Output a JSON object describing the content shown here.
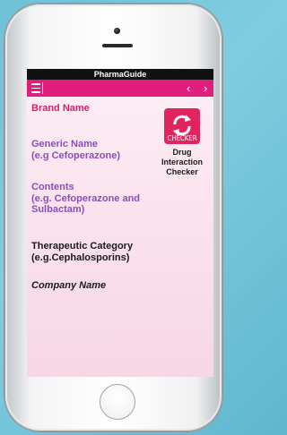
{
  "app": {
    "title": "PharmaGuide"
  },
  "nav": {
    "prev_arrow": "‹",
    "next_arrow": "›"
  },
  "fields": {
    "brand_name": "Brand Name",
    "generic_name_line1": "Generic Name",
    "generic_name_line2": "(e.g Cefoperazone)",
    "contents_line1": "Contents",
    "contents_line2": "(e.g. Cefoperazone and",
    "contents_line3": "Sulbactam)",
    "therapeutic_line1": "Therapeutic Category",
    "therapeutic_line2": "(e.g.Cephalosporins)",
    "company_name": "Company Name"
  },
  "checker": {
    "icon_text": "CHECKER",
    "label_line1": "Drug",
    "label_line2": "Interaction",
    "label_line3": "Checker"
  },
  "colors": {
    "accent": "#e01f7d",
    "purple_text": "#8b4dbb",
    "magenta_text": "#d8206f",
    "screen_bg": "#fbe3ee",
    "page_bg": "#6fc1d6"
  },
  "icons": [
    "menu-icon",
    "chevron-left-icon",
    "chevron-right-icon",
    "interaction-checker-icon"
  ]
}
